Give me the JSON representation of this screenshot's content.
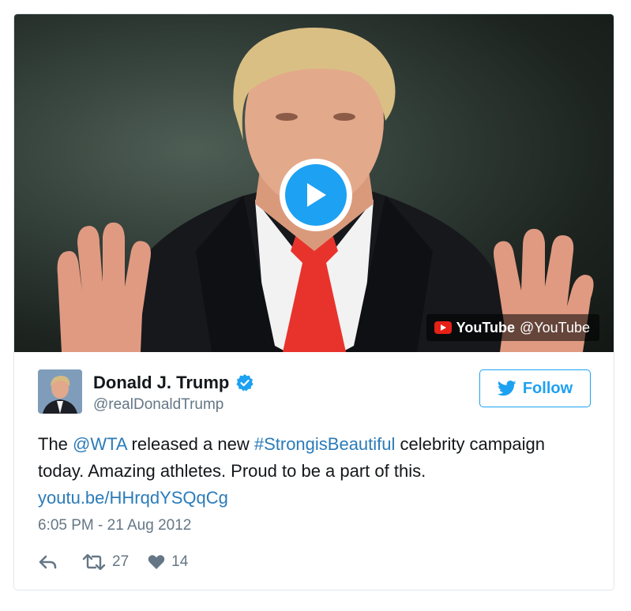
{
  "media": {
    "provider_brand": "YouTube",
    "provider_handle": "@YouTube",
    "play_icon": "play-icon",
    "play_color": "#1da1f2",
    "youtube_red": "#e62117"
  },
  "author": {
    "name": "Donald J. Trump",
    "handle": "@realDonaldTrump",
    "verified_icon": "verified-badge-icon"
  },
  "follow_button": {
    "label": "Follow",
    "icon": "twitter-bird-icon"
  },
  "tweet": {
    "text_part1": "The ",
    "mention": "@WTA",
    "text_part2": " released a new ",
    "hashtag": "#StrongisBeautiful",
    "text_part3": " celebrity campaign today. Amazing athletes. Proud to be a part of this.",
    "link": "youtu.be/HHrqdYSQqCg",
    "timestamp": "6:05 PM - 21 Aug 2012"
  },
  "actions": {
    "reply_icon": "reply-icon",
    "retweet_icon": "retweet-icon",
    "retweet_count": "27",
    "like_icon": "heart-icon",
    "like_count": "14"
  },
  "colors": {
    "link": "#2b7bb9",
    "accent": "#1da1f2",
    "muted": "#657786",
    "border": "#e1e8ed"
  }
}
